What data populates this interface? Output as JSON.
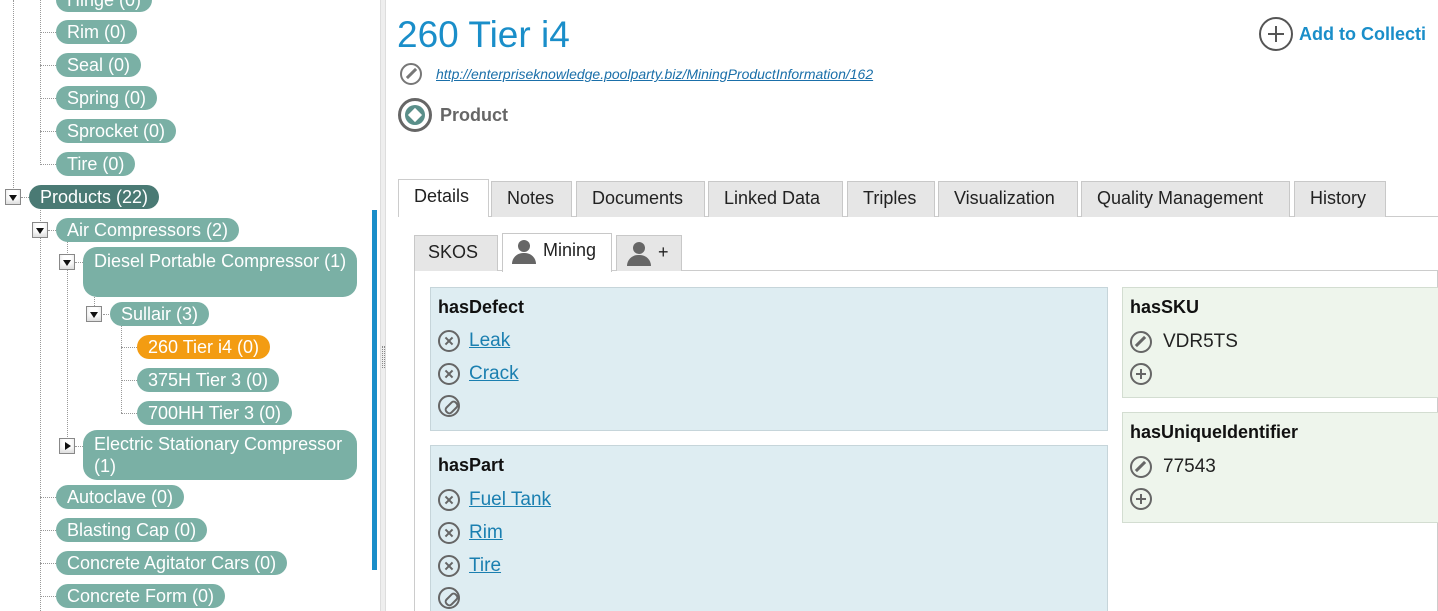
{
  "tree": {
    "nodes": [
      {
        "label": "Hinge (0)"
      },
      {
        "label": "Rim (0)"
      },
      {
        "label": "Seal (0)"
      },
      {
        "label": "Spring (0)"
      },
      {
        "label": "Sprocket (0)"
      },
      {
        "label": "Tire (0)"
      },
      {
        "label": "Products (22)"
      },
      {
        "label": "Air Compressors (2)"
      },
      {
        "label": "Diesel Portable Compressor (1)"
      },
      {
        "label": "Sullair (3)"
      },
      {
        "label": "260 Tier i4 (0)"
      },
      {
        "label": "375H Tier 3 (0)"
      },
      {
        "label": "700HH Tier 3 (0)"
      },
      {
        "label": "Electric Stationary Compressor (1)"
      },
      {
        "label": "Autoclave (0)"
      },
      {
        "label": "Blasting Cap (0)"
      },
      {
        "label": "Concrete Agitator Cars (0)"
      },
      {
        "label": "Concrete Form (0)"
      }
    ],
    "selected_color": "#f39c12",
    "node_color": "#7ab0a5"
  },
  "header": {
    "title": "260 Tier i4",
    "add_to_collection": "Add to Collecti",
    "uri": "http://enterpriseknowledge.poolparty.biz/MiningProductInformation/162",
    "type": "Product",
    "accent_color": "#1a8ec9"
  },
  "tabs": [
    {
      "label": "Details"
    },
    {
      "label": "Notes"
    },
    {
      "label": "Documents"
    },
    {
      "label": "Linked Data"
    },
    {
      "label": "Triples"
    },
    {
      "label": "Visualization"
    },
    {
      "label": "Quality Management"
    },
    {
      "label": "History"
    }
  ],
  "subtabs": [
    {
      "label": "SKOS"
    },
    {
      "label": "Mining"
    },
    {
      "label": "+"
    }
  ],
  "panels": {
    "hasDefect": {
      "title": "hasDefect",
      "items": [
        "Leak",
        "Crack"
      ]
    },
    "hasPart": {
      "title": "hasPart",
      "items": [
        "Fuel Tank",
        "Rim",
        "Tire"
      ]
    },
    "hasSKU": {
      "title": "hasSKU",
      "value": "VDR5TS"
    },
    "hasUniqueIdentifier": {
      "title": "hasUniqueIdentifier",
      "value": "77543"
    }
  }
}
